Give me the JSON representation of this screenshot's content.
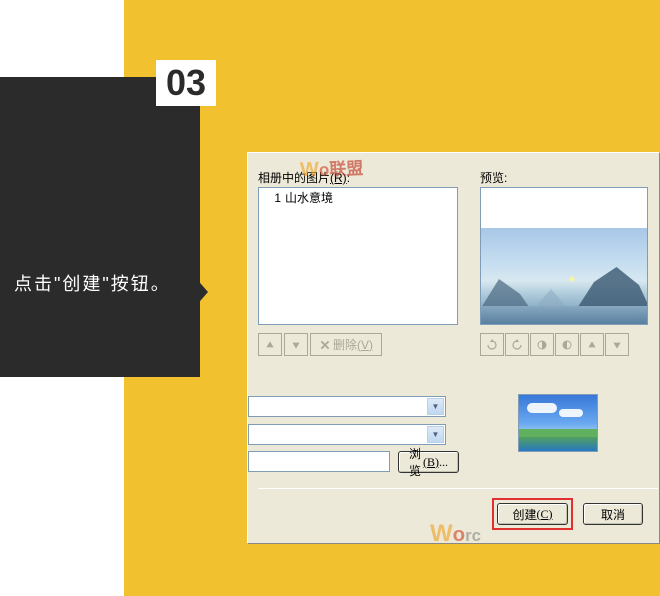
{
  "step": {
    "number": "03",
    "instruction": "点击\"创建\"按钮。"
  },
  "dialog": {
    "labels": {
      "pictures_in_album": "相册中的图片",
      "pictures_key": "(R)",
      "preview": "预览:"
    },
    "list_items": [
      {
        "index": "1",
        "name": "山水意境"
      }
    ],
    "buttons": {
      "remove": "删除",
      "remove_key": "(V)",
      "browse": "浏览",
      "browse_key": "(B)",
      "create": "创建",
      "create_key": "(C)",
      "cancel": "取消"
    }
  },
  "watermark": {
    "prefix_w": "W",
    "prefix_o": "o",
    "domain": "rc",
    "cn": "联盟"
  }
}
